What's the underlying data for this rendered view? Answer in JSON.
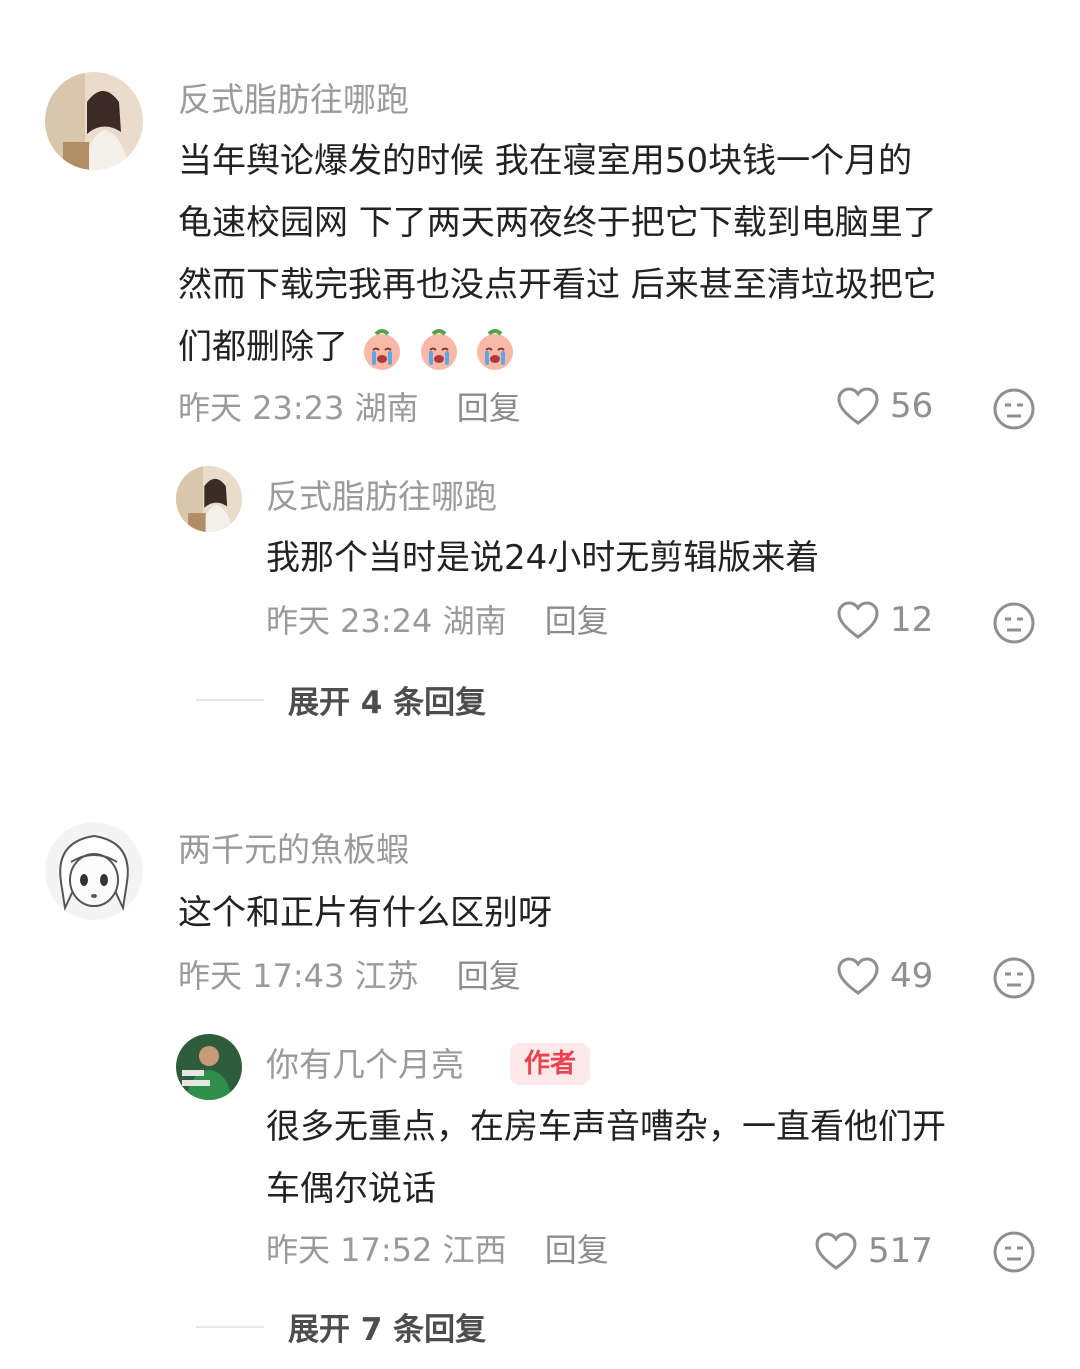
{
  "comments": [
    {
      "username": "反式脂肪往哪跑",
      "text_lines": [
        "当年舆论爆发的时候 我在寝室用50块钱一个月的",
        "龟速校园网 下了两天两夜终于把它下载到电脑里了",
        "然而下载完我再也没点开看过 后来甚至清垃圾把它",
        "们都删除了"
      ],
      "emoji": "crying-face-emoji",
      "time": "昨天 23:23",
      "location": "湖南",
      "reply_label": "回复",
      "likes": "56",
      "replies": [
        {
          "username": "反式脂肪往哪跑",
          "text_lines": [
            "我那个当时是说24小时无剪辑版来着"
          ],
          "time": "昨天 23:24",
          "location": "湖南",
          "reply_label": "回复",
          "likes": "12"
        }
      ],
      "expand_label": "展开 4 条回复"
    },
    {
      "username": "两千元的魚板蝦",
      "text_lines": [
        "这个和正片有什么区别呀"
      ],
      "time": "昨天 17:43",
      "location": "江苏",
      "reply_label": "回复",
      "likes": "49",
      "replies": [
        {
          "username": "你有几个月亮",
          "badge": "作者",
          "text_lines": [
            "很多无重点，在房车声音嘈杂，一直看他们开",
            "车偶尔说话"
          ],
          "time": "昨天 17:52",
          "location": "江西",
          "reply_label": "回复",
          "likes": "517"
        }
      ],
      "expand_label": "展开 7 条回复"
    }
  ],
  "colors": {
    "meta_gray": "#9a9a9a",
    "author_badge_bg": "#fde8ea",
    "author_badge_text": "#e8434f"
  },
  "icons": [
    "heart-outline-icon",
    "dislike-face-icon"
  ]
}
